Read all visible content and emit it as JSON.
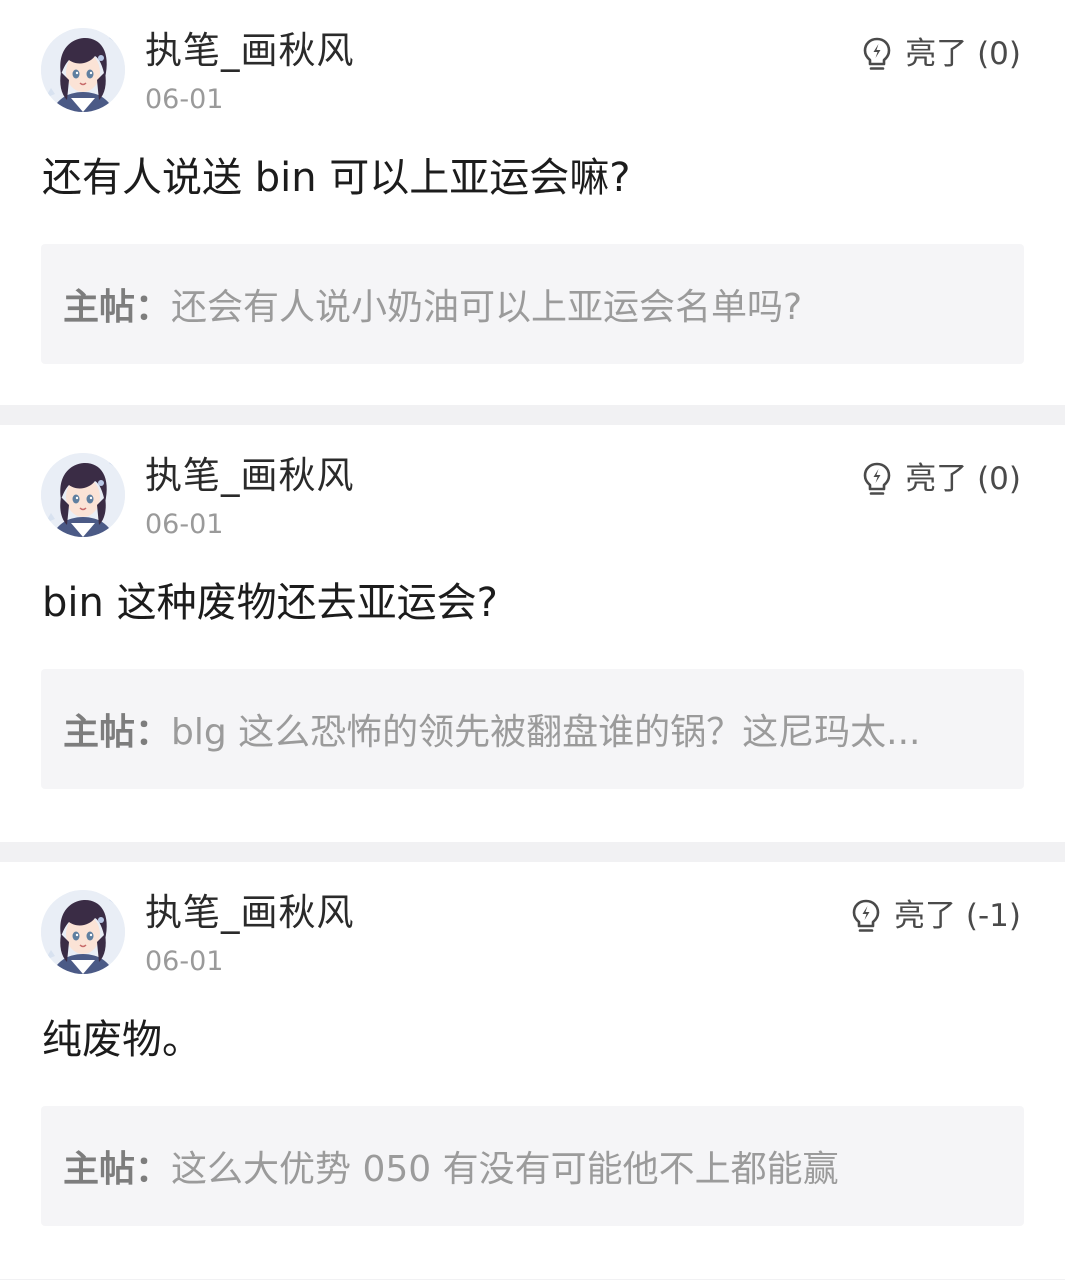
{
  "colors": {
    "background": "#ffffff",
    "divider": "#f1f1f3",
    "quote_bg": "#f5f5f7",
    "username": "#2a2a2a",
    "meta": "#9a9a9a",
    "quote_label": "#7d7d7d",
    "quote_text": "#9b9b9b"
  },
  "replies": [
    {
      "avatar_icon": "anime-avatar-icon",
      "username": "执笔_画秋风",
      "date": "06-01",
      "light_icon": "lightbulb-icon",
      "light_label": "亮了 (0)",
      "content": "还有人说送 bin 可以上亚运会嘛?",
      "quote_label": "主帖：",
      "quote_text": "还会有人说小奶油可以上亚运会名单吗?"
    },
    {
      "avatar_icon": "anime-avatar-icon",
      "username": "执笔_画秋风",
      "date": "06-01",
      "light_icon": "lightbulb-icon",
      "light_label": "亮了 (0)",
      "content": "bin 这种废物还去亚运会?",
      "quote_label": "主帖：",
      "quote_text": "blg 这么恐怖的领先被翻盘谁的锅？这尼玛太..."
    },
    {
      "avatar_icon": "anime-avatar-icon",
      "username": "执笔_画秋风",
      "date": "06-01",
      "light_icon": "lightbulb-icon",
      "light_label": "亮了 (-1)",
      "content": "纯废物。",
      "quote_label": "主帖：",
      "quote_text": "这么大优势 050 有没有可能他不上都能赢"
    }
  ]
}
